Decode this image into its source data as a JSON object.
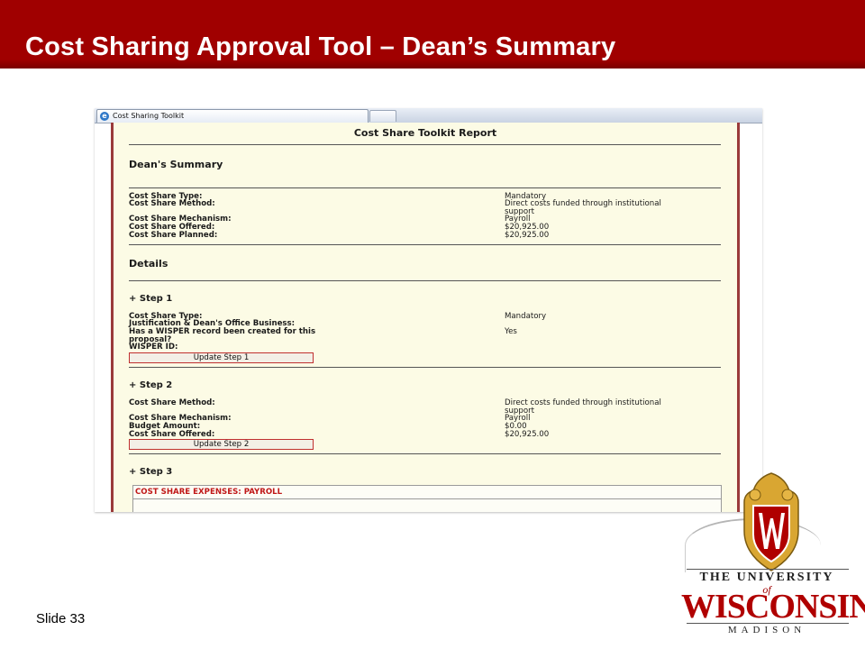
{
  "slide": {
    "title": "Cost Sharing Approval Tool – Dean’s Summary",
    "slide_number": "Slide 33"
  },
  "browser": {
    "tab_title": "Cost Sharing Toolkit"
  },
  "report": {
    "title": "Cost Share Toolkit Report",
    "summary_heading": "Dean's Summary",
    "summary_rows": [
      {
        "label": "Cost Share Type:",
        "value": "Mandatory"
      },
      {
        "label": "Cost Share Method:",
        "value": "Direct costs funded through institutional support"
      },
      {
        "label": "Cost Share Mechanism:",
        "value": "Payroll"
      },
      {
        "label": "Cost Share Offered:",
        "value": "$20,925.00"
      },
      {
        "label": "Cost Share Planned:",
        "value": "$20,925.00"
      }
    ],
    "details_heading": "Details",
    "step1": {
      "heading": "+ Step 1",
      "rows": [
        {
          "label": "Cost Share Type:",
          "value": "Mandatory"
        },
        {
          "label": "Justification & Dean's Office Business:",
          "value": ""
        },
        {
          "label": "Has a WISPER record been created for this proposal?",
          "value": "Yes"
        },
        {
          "label": "WISPER ID:",
          "value": ""
        }
      ],
      "button": "Update Step 1"
    },
    "step2": {
      "heading": "+ Step 2",
      "rows": [
        {
          "label": "Cost Share Method:",
          "value": "Direct costs funded through institutional support"
        },
        {
          "label": "Cost Share Mechanism:",
          "value": "Payroll"
        },
        {
          "label": "Budget Amount:",
          "value": "$0.00"
        },
        {
          "label": "Cost Share Offered:",
          "value": "$20,925.00"
        }
      ],
      "button": "Update Step 2"
    },
    "step3": {
      "heading": "+ Step 3",
      "expenses_heading": "COST SHARE EXPENSES: PAYROLL"
    }
  },
  "logo": {
    "the_university": "THE UNIVERSITY",
    "of": "of",
    "name": "WISCONSIN",
    "madison": "MADISON"
  },
  "colors": {
    "brand_red": "#a00000",
    "report_background": "#fcfbe5",
    "crest_gold": "#d9a632"
  }
}
